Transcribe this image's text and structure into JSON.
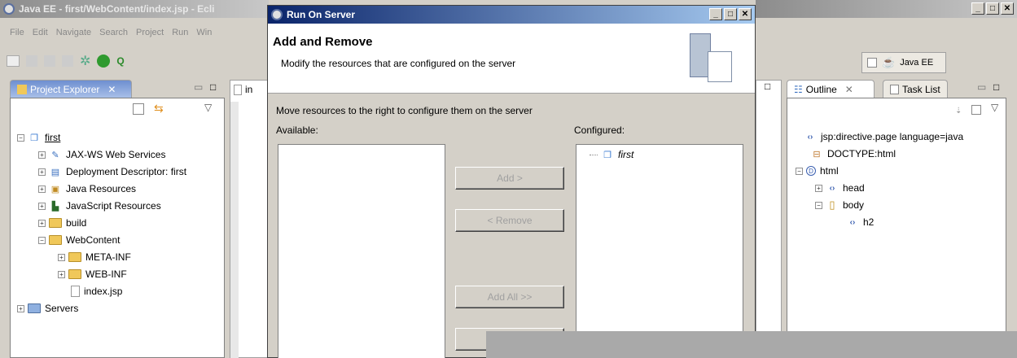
{
  "eclipse": {
    "window_title": "Java EE - first/WebContent/index.jsp - Ecli",
    "menu": [
      "File",
      "Edit",
      "Navigate",
      "Search",
      "Project",
      "Run",
      "Win"
    ],
    "perspective": "Java EE",
    "project_explorer": {
      "tab_label": "Project Explorer",
      "tree": [
        {
          "label": "first",
          "icon": "project-icon",
          "expanded": true
        },
        {
          "label": "JAX-WS Web Services",
          "icon": "web-services-icon"
        },
        {
          "label": "Deployment Descriptor: first",
          "icon": "descriptor-icon"
        },
        {
          "label": "Java Resources",
          "icon": "java-resources-icon"
        },
        {
          "label": "JavaScript Resources",
          "icon": "javascript-resources-icon"
        },
        {
          "label": "build",
          "icon": "folder-icon"
        },
        {
          "label": "WebContent",
          "icon": "folder-icon",
          "expanded": true
        },
        {
          "label": "META-INF",
          "icon": "folder-icon"
        },
        {
          "label": "WEB-INF",
          "icon": "folder-icon"
        },
        {
          "label": "index.jsp",
          "icon": "file-icon"
        },
        {
          "label": "Servers",
          "icon": "folder-icon"
        }
      ]
    },
    "editor_tab": "in",
    "outline": {
      "tab_label": "Outline",
      "task_list_label": "Task List",
      "tree": [
        {
          "label": "jsp:directive.page language=java",
          "icon": "tag-icon"
        },
        {
          "label": "DOCTYPE:html",
          "icon": "doctype-icon"
        },
        {
          "label": "html",
          "icon": "element-icon",
          "expanded": true
        },
        {
          "label": "head",
          "icon": "tag-icon"
        },
        {
          "label": "body",
          "icon": "element-icon",
          "expanded": true
        },
        {
          "label": "h2",
          "icon": "tag-icon"
        }
      ]
    }
  },
  "dialog": {
    "title": "Run On Server",
    "heading": "Add and Remove",
    "description": "Modify the resources that are configured on the server",
    "instruction": "Move resources to the right to configure them on the server",
    "available_label": "Available:",
    "configured_label": "Configured:",
    "configured_items": [
      "first"
    ],
    "buttons": {
      "add": "Add >",
      "remove": "< Remove",
      "add_all": "Add All >>"
    }
  },
  "colors": {
    "active_title": "#0a246a",
    "chrome": "#d4d0c8",
    "gray_overlay": "#a9a9a9"
  }
}
